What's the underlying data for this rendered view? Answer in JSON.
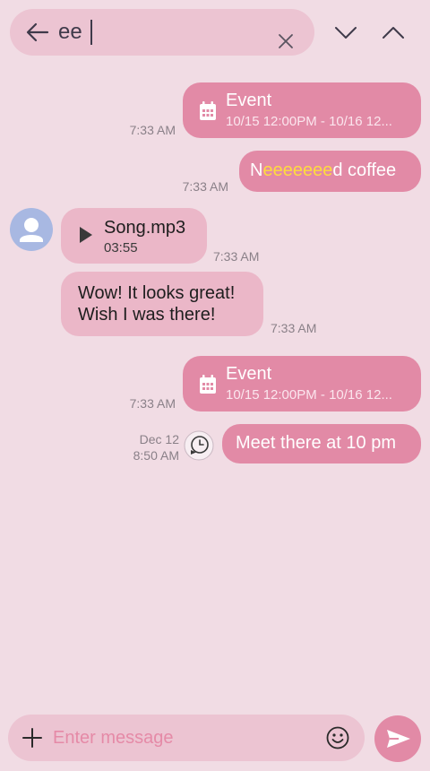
{
  "search": {
    "query": "ee",
    "back_icon": "arrow-left-icon",
    "clear_icon": "close-icon",
    "next_icon": "chevron-down-icon",
    "prev_icon": "chevron-up-icon"
  },
  "messages": [
    {
      "kind": "event",
      "direction": "sent",
      "title": "Event",
      "range": "10/15 12:00PM - 10/16 12...",
      "time": "7:33 AM"
    },
    {
      "kind": "text",
      "direction": "sent",
      "parts": [
        "N",
        "eeeeeee",
        "d coffee"
      ],
      "time": "7:33 AM"
    },
    {
      "kind": "audio",
      "direction": "received",
      "file_name": "Song.mp3",
      "duration": "03:55",
      "time": "7:33 AM"
    },
    {
      "kind": "text",
      "direction": "received",
      "line1": "Wow! It looks great!",
      "line2": "Wish I was there!",
      "time": "7:33 AM"
    },
    {
      "kind": "event",
      "direction": "sent",
      "title": "Event",
      "range": "10/15 12:00PM - 10/16 12...",
      "time": "7:33 AM"
    },
    {
      "kind": "scheduled",
      "direction": "sent",
      "text": "Meet there at 10 pm",
      "date": "Dec 12",
      "time": "8:50 AM"
    }
  ],
  "composer": {
    "placeholder": "Enter message",
    "add_icon": "plus-icon",
    "emoji_icon": "smiley-icon",
    "send_icon": "send-icon"
  },
  "colors": {
    "background": "#f1dce4",
    "sent_bubble": "#e28aa6",
    "received_bubble": "#ebb7c8",
    "highlight": "#ffdc3c",
    "avatar": "#a8b8e2"
  }
}
